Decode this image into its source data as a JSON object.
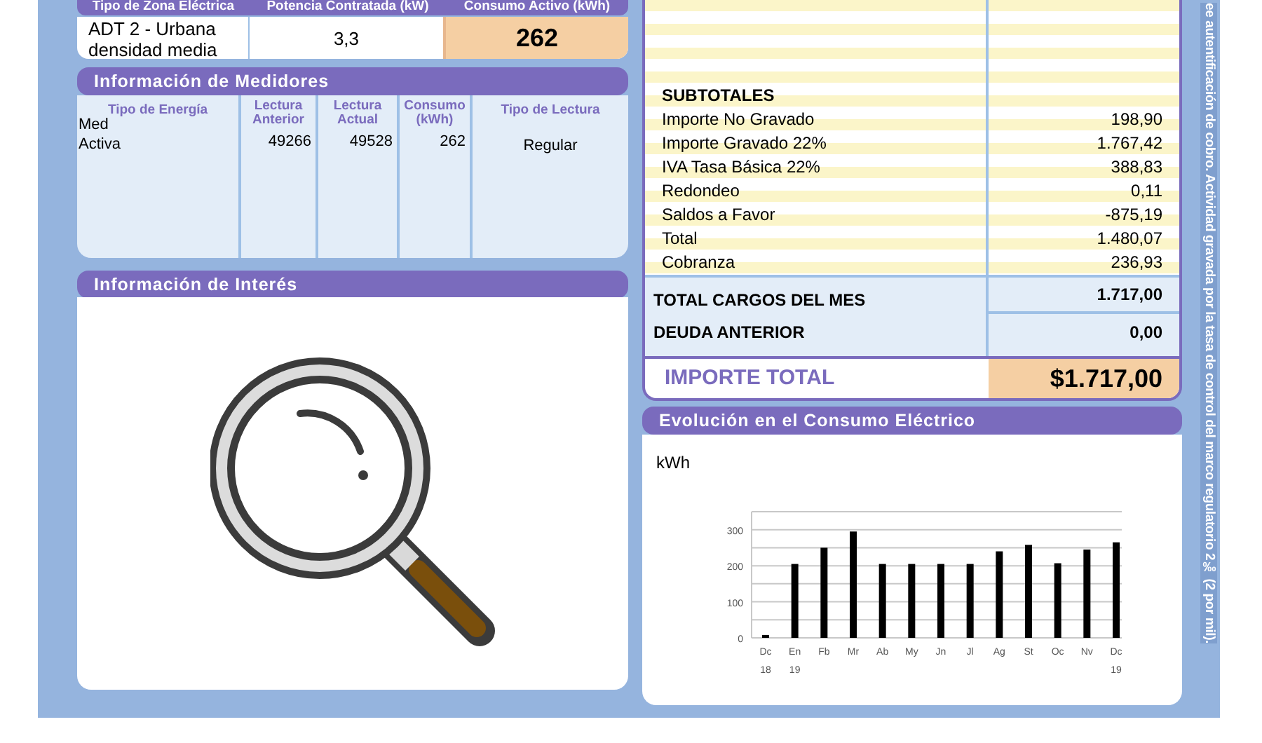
{
  "supply": {
    "columns": [
      "Tipo de Zona Eléctrica",
      "Potencia Contratada (kW)",
      "Consumo Activo (kWh)"
    ],
    "values": [
      "ADT 2 - Urbana densidad media",
      "3,3",
      "262"
    ]
  },
  "meters": {
    "title": "Información de Medidores",
    "columns": [
      "Tipo de Energía",
      "Lectura Anterior",
      "Lectura Actual",
      "Consumo (kWh)",
      "Tipo de Lectura"
    ],
    "group_label": "Med",
    "rows": [
      {
        "energy": "Activa",
        "previous": "49266",
        "current": "49528",
        "consumption": "262",
        "reading_type": "Regular"
      }
    ]
  },
  "interest": {
    "title": "Información de Interés"
  },
  "charges": {
    "heading": "SUBTOTALES",
    "rows": [
      {
        "label": "Importe No Gravado",
        "amount": "198,90"
      },
      {
        "label": "Importe Gravado 22%",
        "amount": "1.767,42"
      },
      {
        "label": "IVA Tasa Básica 22%",
        "amount": "388,83"
      },
      {
        "label": "Redondeo",
        "amount": "0,11"
      },
      {
        "label": "Saldos a Favor",
        "amount": "-875,19"
      },
      {
        "label": "Total",
        "amount": "1.480,07"
      },
      {
        "label": "Cobranza",
        "amount": "236,93"
      }
    ],
    "totals": [
      {
        "label": "TOTAL CARGOS DEL MES",
        "amount": "1.717,00"
      },
      {
        "label": "DEUDA ANTERIOR",
        "amount": "0,00"
      }
    ],
    "grand_total": {
      "label": "IMPORTE TOTAL",
      "amount": "$1.717,00"
    }
  },
  "evolution": {
    "title": "Evolución en el Consumo Eléctrico",
    "unit": "kWh",
    "chart_data": {
      "type": "bar",
      "categories": [
        "Dc 18",
        "En 19",
        "Fb",
        "Mr",
        "Ab",
        "My",
        "Jn",
        "Jl",
        "Ag",
        "St",
        "Oc",
        "Nv",
        "Dc 19"
      ],
      "series": [
        {
          "color": "#000000",
          "values": [
            8,
            205,
            250,
            295,
            205,
            205,
            205,
            205,
            240,
            258,
            207,
            245,
            265
          ]
        }
      ],
      "ylim": [
        0,
        350
      ],
      "yticks": [
        0,
        100,
        200,
        300
      ],
      "grid": true
    }
  },
  "side_note": "ee autentificación de cobro. Actividad gravada por la tasa de control del marco regulatorio 2‰ (2 por mil)."
}
